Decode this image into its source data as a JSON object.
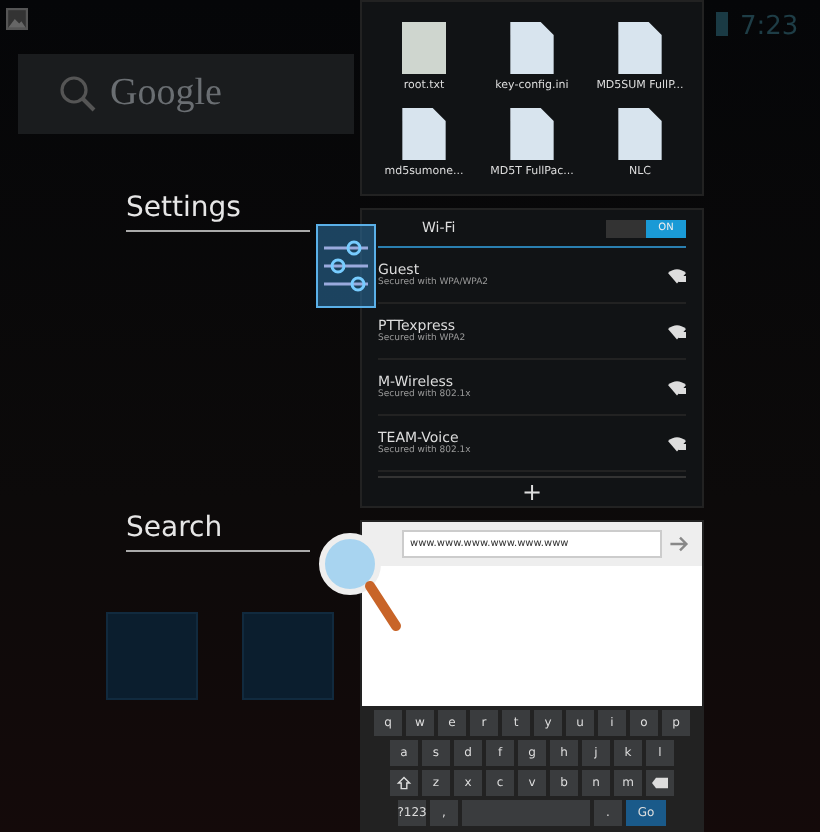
{
  "status_bar": {
    "time": "7:23"
  },
  "home": {
    "search_placeholder": "Google",
    "labels": [
      {
        "text": "Settings"
      },
      {
        "text": "Search"
      }
    ]
  },
  "files": [
    {
      "name": "root.txt",
      "kind": "image"
    },
    {
      "name": "key-config.ini",
      "kind": "doc"
    },
    {
      "name": "MD5SUM FullP...",
      "kind": "doc"
    },
    {
      "name": "md5sumone...",
      "kind": "doc"
    },
    {
      "name": "MD5T FullPac...",
      "kind": "doc"
    },
    {
      "name": "NLC",
      "kind": "doc"
    }
  ],
  "wifi": {
    "title": "Wi-Fi",
    "toggle": {
      "label": "ON",
      "on": true
    },
    "networks": [
      {
        "name": "Guest",
        "status": "Secured with WPA/WPA2"
      },
      {
        "name": "PTTexpress",
        "status": "Secured with WPA2"
      },
      {
        "name": "M-Wireless",
        "status": "Secured with 802.1x"
      },
      {
        "name": "TEAM-Voice",
        "status": "Secured with 802.1x"
      }
    ],
    "add": "+"
  },
  "browser": {
    "url": "www.www.www.www.www.www"
  },
  "keyboard": {
    "rows": [
      [
        {
          "kind": "char",
          "label": "q"
        },
        {
          "kind": "char",
          "label": "w"
        },
        {
          "kind": "char",
          "label": "e"
        },
        {
          "kind": "char",
          "label": "r"
        },
        {
          "kind": "char",
          "label": "t"
        },
        {
          "kind": "char",
          "label": "y"
        },
        {
          "kind": "char",
          "label": "u"
        },
        {
          "kind": "char",
          "label": "i"
        },
        {
          "kind": "char",
          "label": "o"
        },
        {
          "kind": "char",
          "label": "p"
        }
      ],
      [
        {
          "kind": "char",
          "label": "a"
        },
        {
          "kind": "char",
          "label": "s"
        },
        {
          "kind": "char",
          "label": "d"
        },
        {
          "kind": "char",
          "label": "f"
        },
        {
          "kind": "char",
          "label": "g"
        },
        {
          "kind": "char",
          "label": "h"
        },
        {
          "kind": "char",
          "label": "j"
        },
        {
          "kind": "char",
          "label": "k"
        },
        {
          "kind": "char",
          "label": "l"
        }
      ],
      [
        {
          "kind": "shift"
        },
        {
          "kind": "char",
          "label": "z"
        },
        {
          "kind": "char",
          "label": "x"
        },
        {
          "kind": "char",
          "label": "c"
        },
        {
          "kind": "char",
          "label": "v"
        },
        {
          "kind": "char",
          "label": "b"
        },
        {
          "kind": "char",
          "label": "n"
        },
        {
          "kind": "char",
          "label": "m"
        },
        {
          "kind": "delete"
        }
      ],
      [
        {
          "kind": "char",
          "label": "?123"
        },
        {
          "kind": "char",
          "label": ","
        },
        {
          "kind": "space"
        },
        {
          "kind": "char",
          "label": "."
        },
        {
          "kind": "go",
          "label": "Go"
        }
      ]
    ]
  }
}
